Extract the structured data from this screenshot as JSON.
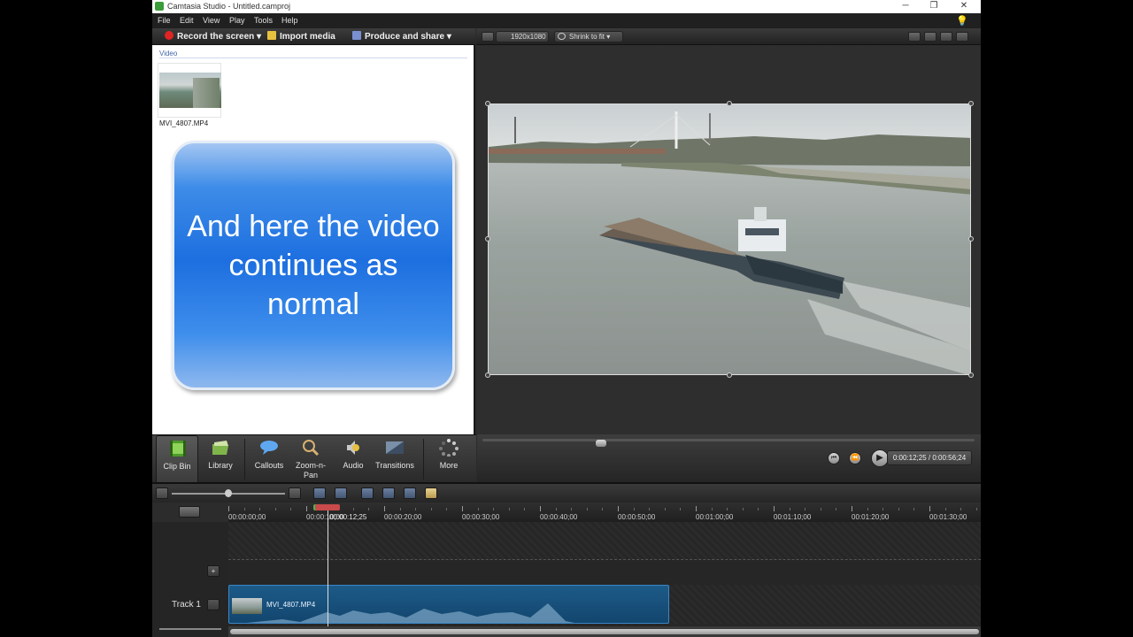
{
  "window": {
    "title": "Camtasia Studio - Untitled.camproj",
    "minimize": "─",
    "restore": "❐",
    "close": "✕"
  },
  "menu": [
    "File",
    "Edit",
    "View",
    "Play",
    "Tools",
    "Help"
  ],
  "toolbar": {
    "record_label": "Record the screen",
    "import_label": "Import media",
    "produce_label": "Produce and share",
    "dropdown_glyph": "▾"
  },
  "preview_toolbar": {
    "dimensions": "1920x1080",
    "zoom": "Shrink to fit"
  },
  "clip_bin": {
    "section_label": "Video",
    "media_name": "MVI_4807.MP4"
  },
  "callout": {
    "text": "And here the video continues as normal",
    "gradient_top": "#a4c6f2",
    "gradient_mid": "#1d6fe0"
  },
  "tabs": [
    {
      "label": "Clip Bin",
      "icon": "film-strip-icon"
    },
    {
      "label": "Library",
      "icon": "folder-icon"
    },
    {
      "label": "Callouts",
      "icon": "speech-bubble-icon"
    },
    {
      "label": "Zoom-n-Pan",
      "icon": "magnifier-icon"
    },
    {
      "label": "Audio",
      "icon": "speaker-icon"
    },
    {
      "label": "Transitions",
      "icon": "transitions-icon"
    },
    {
      "label": "More",
      "icon": "more-dots-icon"
    }
  ],
  "player": {
    "timecode": "0:00:12;25 / 0:00:56;24",
    "position_fraction": 0.23,
    "buttons": {
      "prev": "⏮",
      "rewind": "⏪",
      "play": "▶",
      "forward": "⏩",
      "next": "⏭"
    }
  },
  "timeline": {
    "playhead_time": "00:00:12;25",
    "ticks": [
      "00:00:00;00",
      "00:00:10;00",
      "00:00:20;00",
      "00:00:30;00",
      "00:00:40;00",
      "00:00:50;00",
      "00:01:00;00",
      "00:01:10;00",
      "00:01:20;00",
      "00:01:30;00"
    ],
    "track_label": "Track 1",
    "clip_name": "MVI_4807.MP4",
    "add_track": "+",
    "zoom_fraction": 0.5
  },
  "colors": {
    "app_background": "#2b2b2b",
    "clip_blue": "#1d5a88",
    "record_red": "#e02424",
    "help_yellow": "#f2d600"
  }
}
